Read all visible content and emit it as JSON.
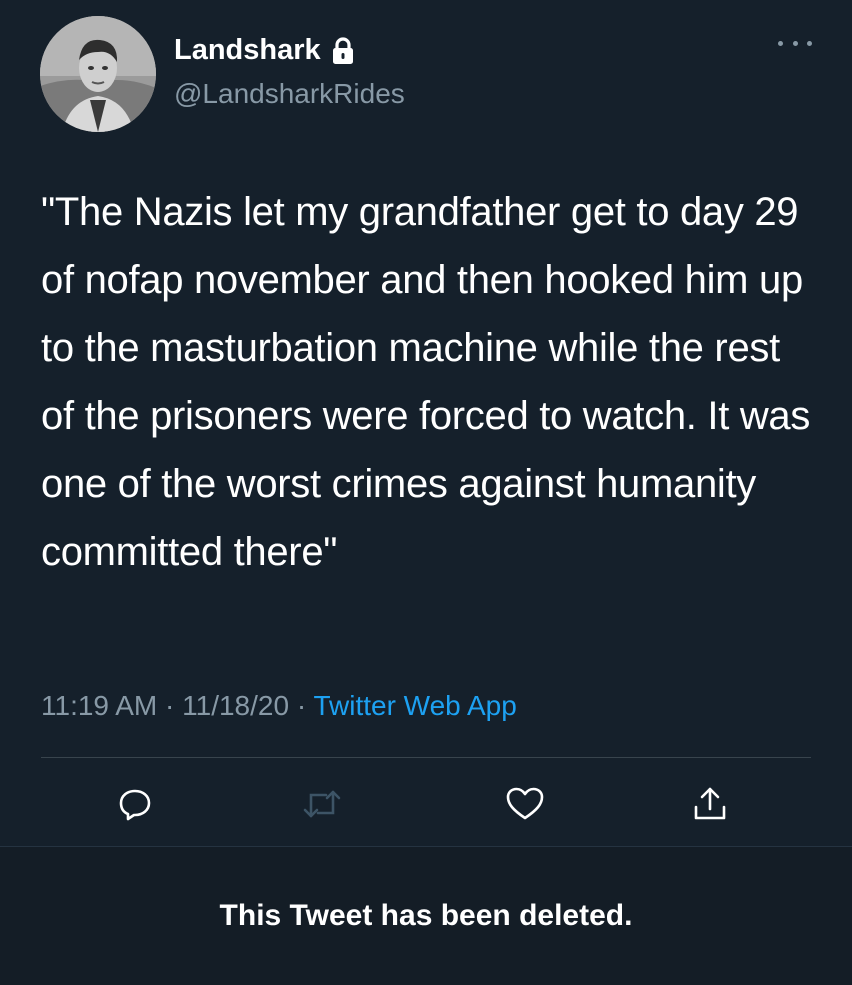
{
  "user": {
    "display_name": "Landshark",
    "handle": "@LandsharkRides"
  },
  "tweet": {
    "text": "\"The Nazis let my grandfather get to day 29 of nofap november and then hooked him up to the masturbation machine while the rest of the prisoners were forced to watch. It was one of the worst crimes against humanity committed there\"",
    "time": "11:19 AM",
    "date": "11/18/20",
    "separator": " · ",
    "source": "Twitter Web App"
  },
  "icons": {
    "avatar": "avatar-photo",
    "lock": "lock-icon",
    "more": "more-icon",
    "reply": "reply-icon",
    "retweet": "retweet-icon",
    "like": "like-icon",
    "share": "share-icon"
  },
  "colors": {
    "background": "#15202b",
    "secondary_text": "#8899a6",
    "link": "#1da1f2",
    "divider": "#38444d"
  },
  "notice": {
    "text": "This Tweet has been deleted."
  }
}
